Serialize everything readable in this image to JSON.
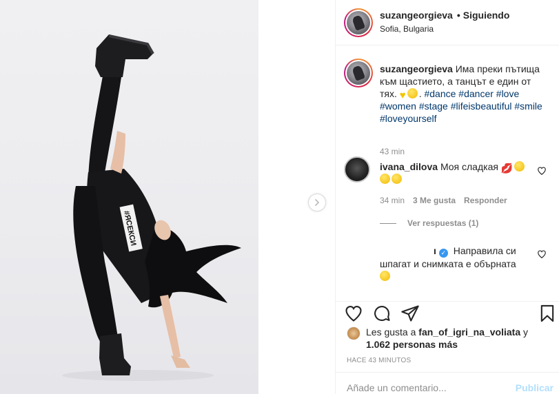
{
  "post": {
    "author": "suzangeorgieva",
    "separator": "•",
    "follow_status": "Siguiendo",
    "location": "Sofia, Bulgaria",
    "photo_shirt_text": "#ЯСЕКСИ"
  },
  "caption": {
    "author": "suzangeorgieva",
    "text": "Има преки пътища към щастието, а танцът е един от тях.",
    "emojis": [
      "yellow-heart",
      "sun"
    ],
    "tail": ".",
    "hashtags": [
      "#dance",
      "#dancer",
      "#love",
      "#women",
      "#stage",
      "#lifeisbeautiful",
      "#smile",
      "#loveyourself"
    ],
    "time": "43 min"
  },
  "comments": [
    {
      "author": "ivana_dilova",
      "text": "Моя сладкая",
      "emojis": [
        "kiss-mark",
        "kissing-face",
        "kissing-face",
        "kissing-face"
      ],
      "time": "34 min",
      "likes": "3 Me gusta",
      "reply_label": "Responder",
      "view_replies": "Ver respuestas (1)"
    },
    {
      "author_suffix": "ı",
      "verified": true,
      "text": "Направила си шпагат и снимката е обърната",
      "emojis": [
        "winking-face-tongue"
      ]
    }
  ],
  "likes": {
    "prefix": "Les gusta a",
    "user": "fan_of_igri_na_voliata",
    "joiner": "y",
    "count": "1.062 personas más"
  },
  "timestamp": "HACE 43 MINUTOS",
  "composer": {
    "placeholder": "Añade un comentario...",
    "post_label": "Publicar"
  },
  "colors": {
    "link": "#00376b",
    "meta": "#8e8e8e",
    "border": "#efefef",
    "publish_disabled": "#b2dffc",
    "verified": "#3897f0"
  },
  "icons": [
    "chevron-right-icon",
    "more-icon",
    "heart-icon",
    "comment-icon",
    "share-icon",
    "bookmark-icon",
    "verified-icon"
  ]
}
